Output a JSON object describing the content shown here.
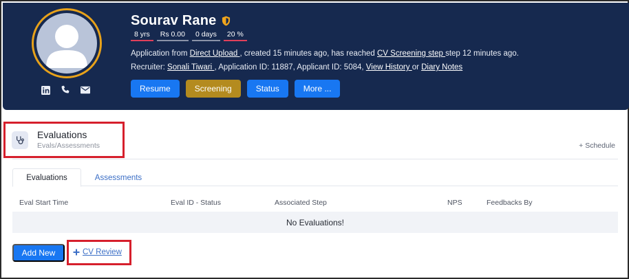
{
  "candidate": {
    "name": "Sourav Rane",
    "stats": [
      "8 yrs",
      "Rs 0.00",
      "0 days",
      "20 %"
    ],
    "application_line": {
      "prefix": "Application from ",
      "source_link": "Direct Upload ",
      "middle": ", created 15 minutes ago, has reached ",
      "step_link": "CV Screening step ",
      "suffix": "step 12 minutes ago."
    },
    "recruiter_line": {
      "prefix": "Recruiter: ",
      "recruiter_link": "Sonali Tiwari ",
      "middle": ", Application ID: 11887, Applicant ID: 5084, ",
      "history_link": "View History ",
      "or": "or ",
      "diary_link": "Diary Notes"
    },
    "buttons": {
      "resume": "Resume",
      "screening": "Screening",
      "status": "Status",
      "more": "More ..."
    },
    "icons": [
      "linkedin-icon",
      "phone-icon",
      "mail-icon",
      "shield-icon",
      "user-avatar-icon"
    ]
  },
  "evaluations": {
    "title": "Evaluations",
    "subtitle": "Evals/Assessments",
    "schedule": "+ Schedule",
    "tabs": [
      "Evaluations",
      "Assessments"
    ],
    "columns": [
      "Eval Start Time",
      "Eval ID - Status",
      "Associated Step",
      "NPS",
      "Feedbacks By"
    ],
    "empty_message": "No Evaluations!",
    "add_new": "Add New",
    "cv_review": "CV Review"
  },
  "colors": {
    "header_bg": "#16294f",
    "primary": "#1877f2",
    "gold": "#b48b1f",
    "highlight": "#d61f2c",
    "ring": "#e8a21a"
  }
}
